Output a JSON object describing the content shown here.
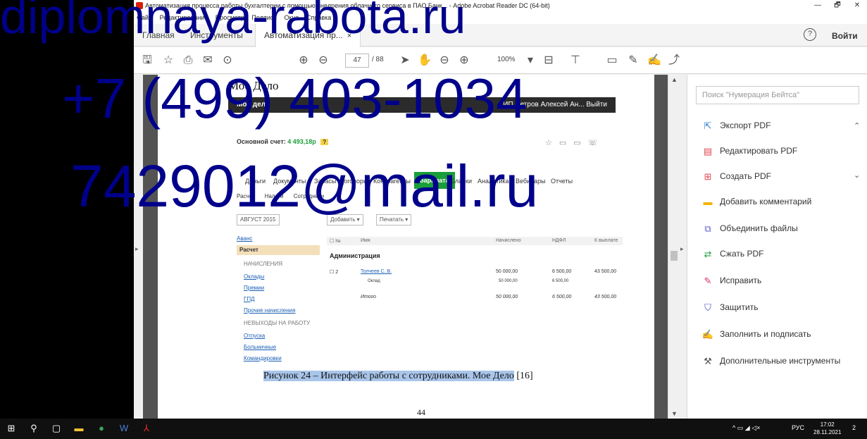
{
  "window": {
    "title": "Автоматизация процесса работы бухгалтерии с помощью внедрения облачного сервиса в ПАО Банк... - Adobe Acrobat Reader DC (64-bit)",
    "controls": [
      "—",
      "🗗",
      "✕"
    ]
  },
  "menu": [
    "Файл",
    "Редактирование",
    "Просмотр",
    "Подпись",
    "Окно",
    "Справка"
  ],
  "tabs": {
    "home": "Главная",
    "tools": "Инструменты",
    "document": "Автоматизация пр...",
    "close": "×"
  },
  "account": {
    "help": "?",
    "signin": "Войти"
  },
  "toolbar": {
    "page_current": "47",
    "page_total": "/ 88",
    "zoom": "100%"
  },
  "page": {
    "screenshot_title": "Мое Дело",
    "app_logo": "Мое дело",
    "app_user": "ИП Петров Алексей Ан...   Выйти",
    "account_label": "Основной счет:",
    "account_value": "4 493,18р",
    "account_badge": "?",
    "nav": [
      "Деньги",
      "Документы",
      "Запасы",
      "Договоры",
      "Контрагенты",
      "Зарплата",
      "Бланки",
      "Аналитика",
      "Вебинары",
      "Отчеты"
    ],
    "subnav": [
      "Расчет",
      "Налоги",
      "Сотрудники"
    ],
    "controls": [
      "АВГУСТ 2015",
      "Добавить ▾",
      "Печатать ▾"
    ],
    "left_menu": {
      "advance": "Аванс",
      "current": "Расчет",
      "accruals_title": "НАЧИСЛЕНИЯ",
      "accruals": [
        "Оклады",
        "Премии",
        "ГПД",
        "Прочие начисления"
      ],
      "absence_title": "НЕВЫХОДЫ НА РАБОТУ",
      "absences": [
        "Отпуска",
        "Больничные",
        "Командировки"
      ]
    },
    "table": {
      "headers": [
        "☐  №",
        "Имя",
        "Начислено",
        "НДФЛ",
        "К выплате"
      ],
      "group": "Администрация",
      "rows": [
        {
          "num": "☐  2",
          "name": "Толчеев С. В.",
          "accrued": "50 000,00",
          "tax": "6 500,00",
          "pay": "43 500,00"
        },
        {
          "num": "",
          "name": "Оклад",
          "accrued": "50 000,00",
          "tax": "6 500,00",
          "pay": ""
        },
        {
          "num": "",
          "name": "Итого",
          "accrued": "50 000,00",
          "tax": "6 500,00",
          "pay": "43 500,00"
        }
      ]
    },
    "caption_highlight": "Рисунок 24 – Интерфейс работы с сотрудниками. Мое Дело",
    "caption_ref": " [16]",
    "page_number": "44"
  },
  "panel": {
    "search_placeholder": "Поиск \"Нумерация Бейтса\"",
    "items": [
      {
        "label": "Экспорт PDF",
        "icon": "export-pdf-icon",
        "color": "#2f7fc9"
      },
      {
        "label": "Редактировать PDF",
        "icon": "edit-pdf-icon",
        "color": "#e34850"
      },
      {
        "label": "Создать PDF",
        "icon": "create-pdf-icon",
        "color": "#e34850"
      },
      {
        "label": "Добавить комментарий",
        "icon": "comment-icon",
        "color": "#f4b400"
      },
      {
        "label": "Объединить файлы",
        "icon": "combine-files-icon",
        "color": "#5b5fc7"
      },
      {
        "label": "Сжать PDF",
        "icon": "compress-pdf-icon",
        "color": "#1a9e3a"
      },
      {
        "label": "Исправить",
        "icon": "redact-icon",
        "color": "#d9346c"
      },
      {
        "label": "Защитить",
        "icon": "protect-icon",
        "color": "#4a4ac4"
      },
      {
        "label": "Заполнить и подписать",
        "icon": "fill-sign-icon",
        "color": "#7a3fb4"
      },
      {
        "label": "Дополнительные инструменты",
        "icon": "more-tools-icon",
        "color": "#555555"
      }
    ]
  },
  "watermark": {
    "line1": "diplomnaya-rabota.ru",
    "line2": "+7 (499) 403-1034",
    "line3": "7429012@mail.ru",
    "color": "#00008b"
  },
  "taskbar": {
    "lang": "РУС",
    "time": "17:02",
    "date": "28.11.2021",
    "notifications": "2"
  }
}
